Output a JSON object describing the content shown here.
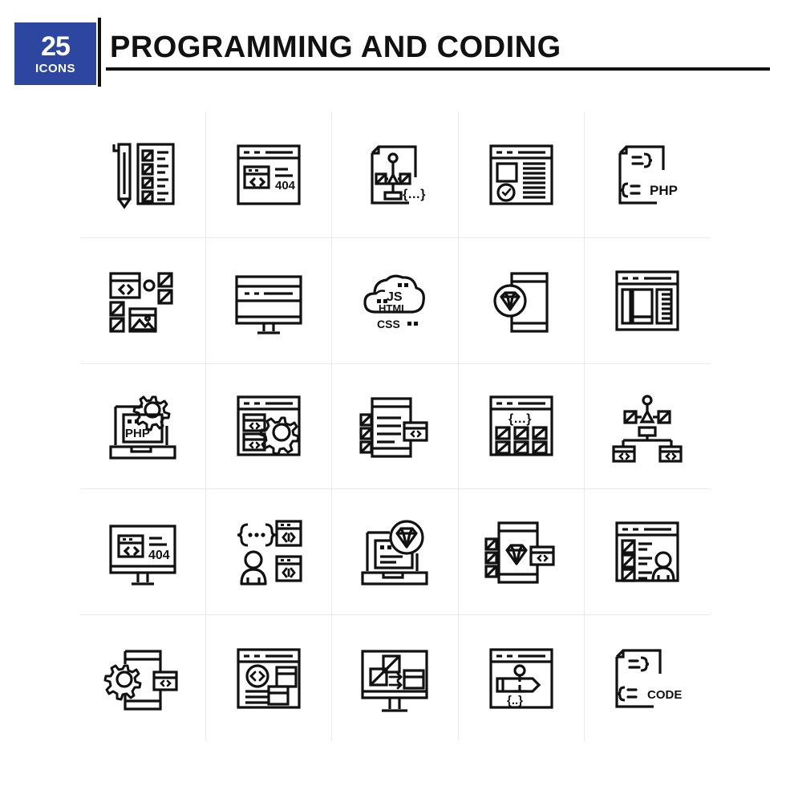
{
  "header": {
    "badge_count": "25",
    "badge_label": "ICONS",
    "title": "PROGRAMMING AND CODING",
    "badge_color": "#2d46a0",
    "rule_color": "#111111",
    "text_color": "#111111"
  },
  "grid": {
    "columns": 5,
    "rows": 5,
    "total_icons": 25,
    "stroke_color": "#111111",
    "separator_color": "#e9e9e9",
    "background": "#ffffff"
  },
  "icons": [
    {
      "index": 1,
      "name": "pencil-checklist-document-icon",
      "label": "Pencil and checklist document",
      "text": ""
    },
    {
      "index": 2,
      "name": "browser-404-code-icon",
      "label": "Browser window 404 error with code",
      "text": "404"
    },
    {
      "index": 3,
      "name": "document-flowchart-braces-icon",
      "label": "Document with flowchart and braces",
      "text": "{…}"
    },
    {
      "index": 4,
      "name": "browser-image-check-icon",
      "label": "Browser with image and check mark",
      "text": ""
    },
    {
      "index": 5,
      "name": "php-document-icon",
      "label": "PHP code document",
      "text": "PHP"
    },
    {
      "index": 6,
      "name": "layout-code-image-blocks-icon",
      "label": "Layout blocks with code and image",
      "text": ""
    },
    {
      "index": 7,
      "name": "desktop-monitor-code-icon",
      "label": "Desktop monitor with code line",
      "text": ""
    },
    {
      "index": 8,
      "name": "cloud-js-html-css-icon",
      "label": "Cloud with JS HTML CSS",
      "text": "JS HTML CSS"
    },
    {
      "index": 9,
      "name": "mobile-diamond-icon",
      "label": "Mobile phone with diamond",
      "text": ""
    },
    {
      "index": 10,
      "name": "browser-column-layout-icon",
      "label": "Browser with column layout",
      "text": ""
    },
    {
      "index": 11,
      "name": "laptop-php-gear-icon",
      "label": "Laptop with PHP and gear",
      "text": "PHP"
    },
    {
      "index": 12,
      "name": "browser-code-blocks-gear-icon",
      "label": "Browser code blocks with gear",
      "text": ""
    },
    {
      "index": 13,
      "name": "mobile-checklist-code-icon",
      "label": "Mobile checklist with code window",
      "text": ""
    },
    {
      "index": 14,
      "name": "browser-braces-image-grid-icon",
      "label": "Browser braces with image grid",
      "text": "{…}"
    },
    {
      "index": 15,
      "name": "sitemap-code-nodes-icon",
      "label": "Sitemap flowchart with code nodes",
      "text": ""
    },
    {
      "index": 16,
      "name": "monitor-404-code-icon",
      "label": "Monitor showing 404 error",
      "text": "404"
    },
    {
      "index": 17,
      "name": "braces-user-code-windows-icon",
      "label": "Braces user and code windows",
      "text": "{…}"
    },
    {
      "index": 18,
      "name": "laptop-diamond-icon",
      "label": "Laptop with diamond",
      "text": ""
    },
    {
      "index": 19,
      "name": "mobile-diamond-checklist-code-icon",
      "label": "Mobile diamond checklist and code",
      "text": ""
    },
    {
      "index": 20,
      "name": "browser-list-user-icon",
      "label": "Browser list with user",
      "text": ""
    },
    {
      "index": 21,
      "name": "mobile-gear-code-icon",
      "label": "Mobile with gear and code window",
      "text": ""
    },
    {
      "index": 22,
      "name": "browser-code-circle-blocks-icon",
      "label": "Browser code circle with blocks",
      "text": ""
    },
    {
      "index": 23,
      "name": "monitor-image-transfer-icon",
      "label": "Monitor image transfer arrows",
      "text": ""
    },
    {
      "index": 24,
      "name": "browser-pencil-braces-icon",
      "label": "Browser with pencil and braces",
      "text": "{..}"
    },
    {
      "index": 25,
      "name": "code-document-icon",
      "label": "CODE document",
      "text": "CODE"
    }
  ],
  "icon_text": {
    "i2_404": "404",
    "i5_php": "PHP",
    "i8_js": "JS",
    "i8_html": "HTML",
    "i8_css": "CSS",
    "i11_php": "PHP",
    "i16_404": "404",
    "i25_code": "CODE"
  }
}
